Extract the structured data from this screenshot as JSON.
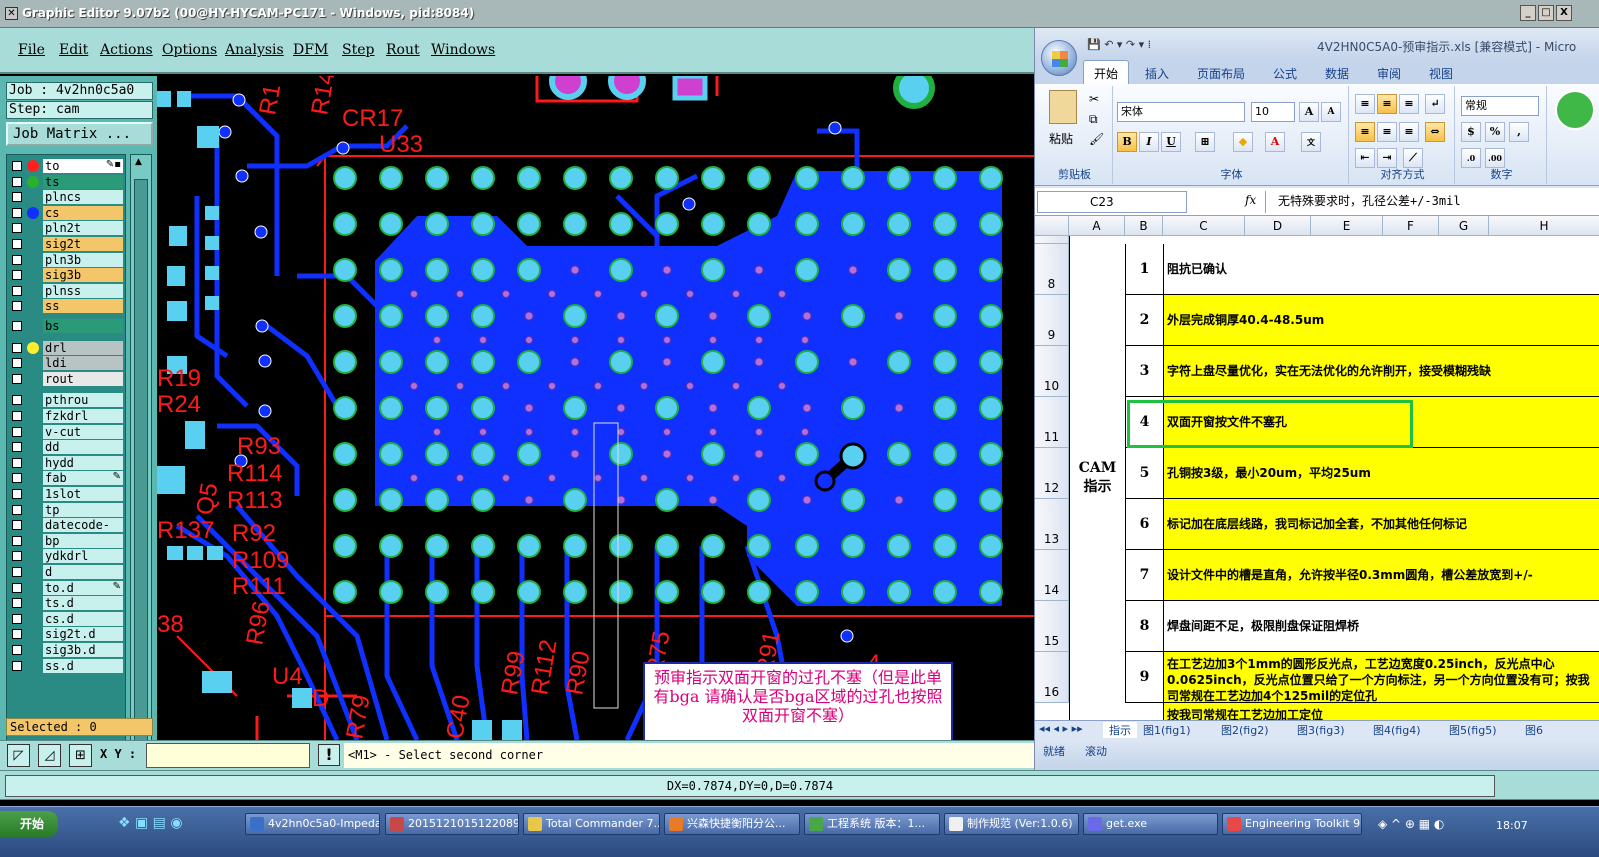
{
  "app": {
    "title": "Graphic Editor 9.07b2 (00@HY-HYCAM-PC171 - Windows, pid:8084)",
    "title_icon": "x-icon",
    "window_buttons": [
      "_",
      "□",
      "X"
    ]
  },
  "menu": [
    "File",
    "Edit",
    "Actions",
    "Options",
    "Analysis",
    "DFM",
    "Step",
    "Rout",
    "Windows"
  ],
  "job": {
    "job": "Job : 4v2hn0c5a0",
    "step": "Step: cam",
    "matrix_label": "Job Matrix ..."
  },
  "layers": [
    {
      "name": "to",
      "bg": "#ffffff",
      "dot": "#ff2020",
      "flag": "✎▪"
    },
    {
      "name": "ts",
      "bg": "#2a9a78",
      "dot": "#2ab02a",
      "flag": ""
    },
    {
      "name": "plncs",
      "bg": "#c8f0ec",
      "dot": "",
      "flag": ""
    },
    {
      "name": "cs",
      "bg": "#f4c66a",
      "dot": "#1030ff",
      "flag": ""
    },
    {
      "name": "pln2t",
      "bg": "#c8f0ec",
      "dot": "",
      "flag": ""
    },
    {
      "name": "sig2t",
      "bg": "#f4c66a",
      "dot": "",
      "flag": ""
    },
    {
      "name": "pln3b",
      "bg": "#c8f0ec",
      "dot": "",
      "flag": ""
    },
    {
      "name": "sig3b",
      "bg": "#f4c66a",
      "dot": "",
      "flag": ""
    },
    {
      "name": "plnss",
      "bg": "#c8f0ec",
      "dot": "",
      "flag": ""
    },
    {
      "name": "ss",
      "bg": "#f4c66a",
      "dot": "",
      "flag": ""
    },
    {
      "name": "bs",
      "bg": "#2a9a78",
      "dot": "",
      "flag": ""
    },
    {
      "name": "drl",
      "bg": "#b8c4c4",
      "dot": "#ffee30",
      "flag": ""
    },
    {
      "name": "ldi",
      "bg": "#b8c4c4",
      "dot": "",
      "flag": ""
    },
    {
      "name": "rout",
      "bg": "#e8e8e8",
      "dot": "",
      "flag": ""
    },
    {
      "name": "pthrou",
      "bg": "#c8f0ec",
      "dot": "",
      "flag": ""
    },
    {
      "name": "fzkdrl",
      "bg": "#c8f0ec",
      "dot": "",
      "flag": ""
    },
    {
      "name": "v-cut",
      "bg": "#c8f0ec",
      "dot": "",
      "flag": ""
    },
    {
      "name": "dd",
      "bg": "#c8f0ec",
      "dot": "",
      "flag": ""
    },
    {
      "name": "hydd",
      "bg": "#c8f0ec",
      "dot": "",
      "flag": ""
    },
    {
      "name": "fab",
      "bg": "#c8f0ec",
      "dot": "",
      "flag": "✎"
    },
    {
      "name": "1slot",
      "bg": "#c8f0ec",
      "dot": "",
      "flag": ""
    },
    {
      "name": "tp",
      "bg": "#c8f0ec",
      "dot": "",
      "flag": ""
    },
    {
      "name": "datecode-ss",
      "bg": "#c8f0ec",
      "dot": "",
      "flag": ""
    },
    {
      "name": "bp",
      "bg": "#c8f0ec",
      "dot": "",
      "flag": ""
    },
    {
      "name": "ydkdrl",
      "bg": "#c8f0ec",
      "dot": "",
      "flag": ""
    },
    {
      "name": "d",
      "bg": "#c8f0ec",
      "dot": "",
      "flag": ""
    },
    {
      "name": "to.d",
      "bg": "#c8f0ec",
      "dot": "",
      "flag": "✎"
    },
    {
      "name": "ts.d",
      "bg": "#c8f0ec",
      "dot": "",
      "flag": ""
    },
    {
      "name": "cs.d",
      "bg": "#c8f0ec",
      "dot": "",
      "flag": ""
    },
    {
      "name": "sig2t.d",
      "bg": "#c8f0ec",
      "dot": "",
      "flag": ""
    },
    {
      "name": "sig3b.d",
      "bg": "#c8f0ec",
      "dot": "",
      "flag": ""
    },
    {
      "name": "ss.d",
      "bg": "#c8f0ec",
      "dot": "",
      "flag": ""
    }
  ],
  "selected": "Selected : 0",
  "bottom": {
    "xy_label": "X Y :",
    "xy_value": "",
    "excl": "!",
    "prompt": "<M1> - Select second corner"
  },
  "dx": "DX=0.7874,DY=0,D=0.7874",
  "canvas_labels": [
    "R1",
    "R14",
    "CR17",
    "U33",
    "R19",
    "R24",
    "R93",
    "R114",
    "R113",
    "Q5",
    "R137",
    "R92",
    "R109",
    "R111",
    "R96",
    "38",
    "R99",
    "R112",
    "R90",
    "R75",
    "R91",
    "U4",
    "D",
    "R79",
    "C40",
    "4"
  ],
  "annotation": "预审指示双面开窗的过孔不塞（但是此单有bga 请确认是否bga区域的过孔也按照双面开窗不塞）",
  "excel": {
    "title": "4V2HN0C5A0-预审指示.xls [兼容模式] - Micro",
    "tabs": [
      "开始",
      "插入",
      "页面布局",
      "公式",
      "数据",
      "审阅",
      "视图"
    ],
    "clip_label": "粘贴",
    "groups": [
      "剪贴板",
      "字体",
      "对齐方式",
      "数字"
    ],
    "font_name": "宋体",
    "font_size": "10",
    "number_format": "常规",
    "font_buttons": [
      "B",
      "I",
      "U"
    ],
    "cell_ref": "C23",
    "fx": "fx",
    "formula": "无特殊要求时，孔径公差+/-3mil",
    "columns": [
      "A",
      "B",
      "C",
      "D",
      "E",
      "F",
      "G",
      "H"
    ],
    "section_label": "CAM\n指示",
    "rows": [
      {
        "row": "8",
        "n": "1",
        "text": "阻抗已确认",
        "fill": "#ffffff"
      },
      {
        "row": "9",
        "n": "2",
        "text": "外层完成铜厚40.4-48.5um",
        "fill": "#ffff00"
      },
      {
        "row": "10",
        "n": "3",
        "text": "字符上盘尽量优化，实在无法优化的允许削开，接受模糊残缺",
        "fill": "#ffff00"
      },
      {
        "row": "11",
        "n": "4",
        "text": "双面开窗按文件不塞孔",
        "fill": "#ffff00"
      },
      {
        "row": "12",
        "n": "5",
        "text": "孔铜按3级，最小20um，平均25um",
        "fill": "#ffff00"
      },
      {
        "row": "13",
        "n": "6",
        "text": "标记加在底层线路，我司标记加全套，不加其他任何标记",
        "fill": "#ffff00"
      },
      {
        "row": "14",
        "n": "7",
        "text": "设计文件中的槽是直角，允许按半径0.3mm圆角，槽公差放宽到+/-",
        "fill": "#ffff00"
      },
      {
        "row": "15",
        "n": "8",
        "text": "焊盘间距不足，极限削盘保证阻焊桥",
        "fill": "#ffffff"
      },
      {
        "row": "16",
        "n": "9",
        "text": "在工艺边加3个1mm的圆形反光点，工艺边宽度0.25inch，反光点中心0.0625inch，反光点位置只给了一个方向标注，另一个方向位置没有可；按我司常规在工艺边加4个125mil的定位孔",
        "fill": "#ffff00"
      }
    ],
    "row_partial": "按我司常规在工艺边加工定位",
    "sheet_tabs": [
      "指示",
      "图1(fig1)",
      "图2(fig2)",
      "图3(fig3)",
      "图4(fig4)",
      "图5(fig5)",
      "图6"
    ],
    "status": [
      "就绪",
      "滚动"
    ]
  },
  "taskbar": {
    "start": "开始",
    "items": [
      {
        "label": "4v2hn0c5a0-Impeda...",
        "color": "#3a70c8"
      },
      {
        "label": "2015121015122089...",
        "color": "#c84848"
      },
      {
        "label": "Total Commander 7....",
        "color": "#e8c848"
      },
      {
        "label": "兴森快捷衡阳分公...",
        "color": "#e87a28"
      },
      {
        "label": "工程系统 版本：1...",
        "color": "#48a848"
      },
      {
        "label": "制作规范 (Ver:1.0.6)",
        "color": "#f0f0f0"
      },
      {
        "label": "get.exe",
        "color": "#6a6ae8"
      },
      {
        "label": "Engineering Toolkit 9...",
        "color": "#e84848"
      }
    ],
    "clock": "18:07"
  },
  "colors": {
    "pcb_blue": "#1030ff",
    "pcb_red": "#ff1a1a",
    "pad_cyan": "#5ad0f0",
    "teal": "#a8dcd8"
  }
}
